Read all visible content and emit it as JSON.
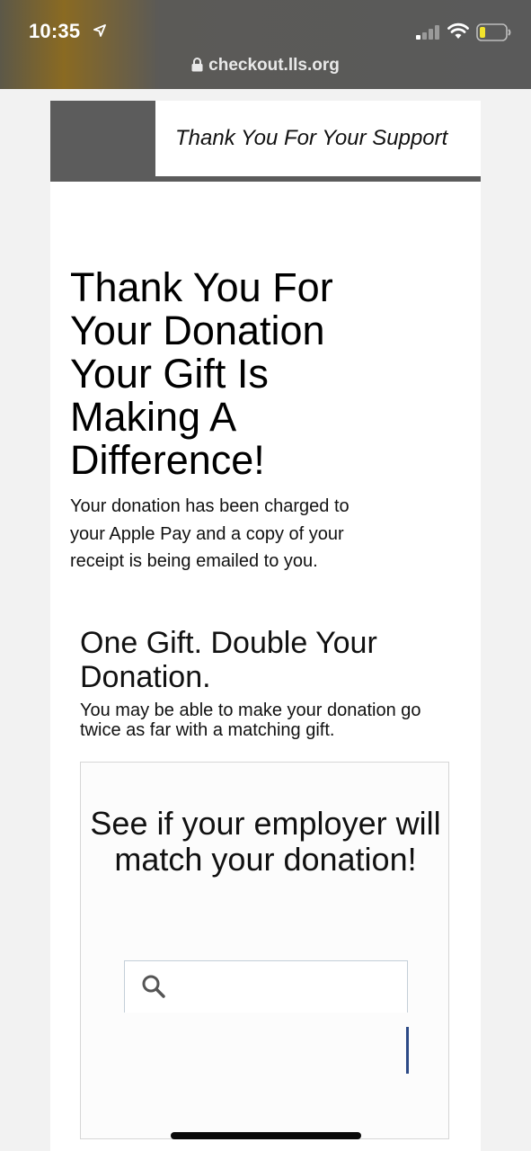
{
  "status_bar": {
    "time": "10:35",
    "url": "checkout.lls.org",
    "icons": [
      "location-arrow-icon",
      "signal-icon",
      "wifi-icon",
      "battery-icon",
      "lock-icon"
    ],
    "battery_color": "#f2e32b"
  },
  "header": {
    "text": "Thank You For Your Support",
    "block_color": "#5c5c5c"
  },
  "main": {
    "title": "Thank You For Your Donation Your Gift Is Making A Difference!",
    "receipt_text": "Your donation has been charged to your Apple Pay and a copy of your receipt is being emailed to you.",
    "match_title": "One Gift. Double Your Donation.",
    "match_subtitle": "You may be able to make your donation go twice as far with a matching gift."
  },
  "employer_match": {
    "title": "See if your employer will match your donation!",
    "search": {
      "value": "",
      "placeholder": "",
      "icon": "search-icon"
    }
  },
  "colors": {
    "cursor": "#2c4a86"
  }
}
